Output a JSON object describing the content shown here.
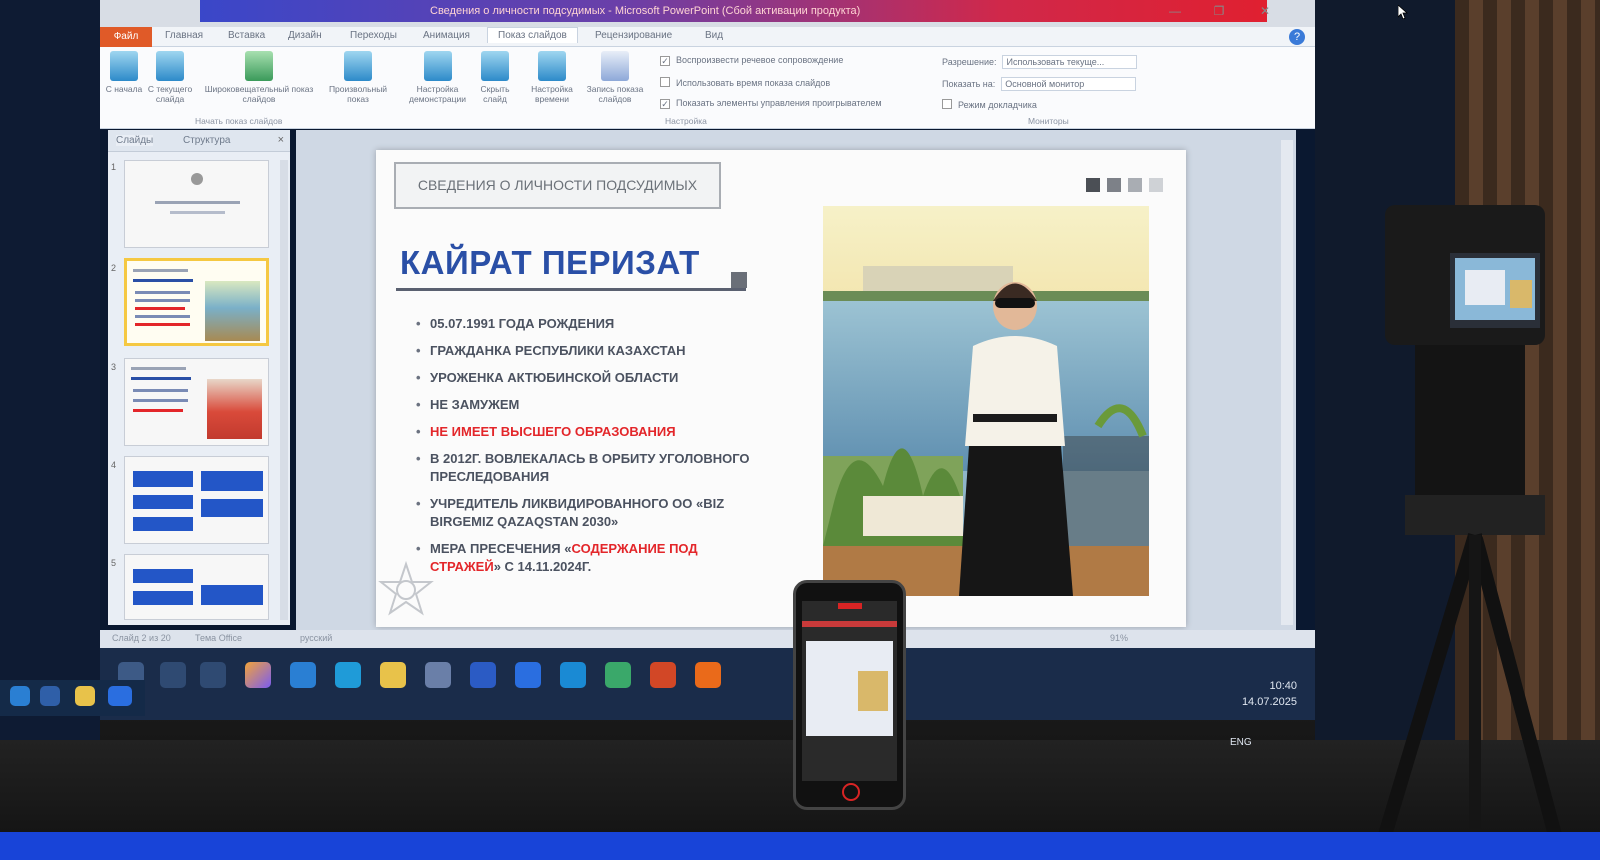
{
  "window": {
    "title": "Сведения о личности подсудимых - Microsoft PowerPoint (Сбой активации продукта)",
    "minimize": "—",
    "maximize": "❐",
    "close": "✕"
  },
  "ribbon": {
    "tabs": [
      "Файл",
      "Главная",
      "Вставка",
      "Дизайн",
      "Переходы",
      "Анимация",
      "Показ слайдов",
      "Рецензирование",
      "Вид"
    ],
    "active_tab": "Показ слайдов",
    "buttons": [
      {
        "label": "С начала",
        "icon": "slideshow-start-icon"
      },
      {
        "label": "С текущего слайда",
        "icon": "slideshow-current-icon"
      },
      {
        "label": "Широковещательный показ слайдов",
        "icon": "broadcast-icon"
      },
      {
        "label": "Произвольный показ",
        "icon": "custom-show-icon"
      },
      {
        "label": "Настройка демонстрации",
        "icon": "setup-show-icon"
      },
      {
        "label": "Скрыть слайд",
        "icon": "hide-slide-icon"
      },
      {
        "label": "Настройка времени",
        "icon": "rehearse-timings-icon"
      },
      {
        "label": "Запись показа слайдов",
        "icon": "record-show-icon"
      }
    ],
    "groups": [
      "Начать показ слайдов",
      "Настройка",
      "Мониторы"
    ],
    "checkboxes": [
      {
        "label": "Воспроизвести речевое сопровождение",
        "checked": true
      },
      {
        "label": "Использовать время показа слайдов",
        "checked": false
      },
      {
        "label": "Показать элементы управления проигрывателем",
        "checked": true
      }
    ],
    "monitors": {
      "resolution_label": "Разрешение:",
      "resolution_value": "Использовать текуще...",
      "show_on_label": "Показать на:",
      "show_on_value": "Основной монитор",
      "presenter_label": "Режим докладчика"
    }
  },
  "panel": {
    "tabs": [
      "Слайды",
      "Структура"
    ],
    "close": "×",
    "slides": [
      "1",
      "2",
      "3",
      "4",
      "5"
    ],
    "selected_slide": 2
  },
  "slide": {
    "header": "СВЕДЕНИЯ О ЛИЧНОСТИ ПОДСУДИМЫХ",
    "name": "КАЙРАТ ПЕРИЗАТ",
    "bullets": [
      "05.07.1991 ГОДА РОЖДЕНИЯ",
      "ГРАЖДАНКА РЕСПУБЛИКИ КАЗАХСТАН",
      "УРОЖЕНКА АКТЮБИНСКОЙ ОБЛАСТИ",
      "НЕ ЗАМУЖЕМ",
      "НЕ ИМЕЕТ ВЫСШЕГО ОБРАЗОВАНИЯ",
      "В 2012Г. ВОВЛЕКАЛАСЬ В ОРБИТУ УГОЛОВНОГО ПРЕСЛЕДОВАНИЯ",
      "УЧРЕДИТЕЛЬ ЛИКВИДИРОВАННОГО ОО «BIZ BIRGEMIZ QAZAQSTAN 2030»"
    ],
    "last_bullet_prefix": "МЕРА ПРЕСЕЧЕНИЯ «",
    "last_bullet_red": "СОДЕРЖАНИЕ ПОД СТРАЖЕЙ",
    "last_bullet_suffix": "» С 14.11.2024Г.",
    "square_colors": [
      "#4b4f55",
      "#7d8188",
      "#a9adb3",
      "#cfd2d6"
    ]
  },
  "status": {
    "slide_info": "Слайд 2 из 20",
    "theme": "Тема Office",
    "language": "русский",
    "zoom": "91%"
  },
  "taskbar": {
    "icons": [
      "windows-start-icon",
      "search-icon",
      "task-view-icon",
      "copilot-icon",
      "edge-icon",
      "edge-icon",
      "file-explorer-icon",
      "store-icon",
      "word-icon",
      "zoom-icon",
      "skype-icon",
      "app-icon",
      "powerpoint-icon",
      "firefox-icon"
    ],
    "time": "10:40",
    "date": "14.07.2025",
    "language": "ENG"
  },
  "colors": {
    "accent_blue": "#2a4fa6",
    "alert_red": "#e3262a",
    "file_tab": "#e05a28"
  }
}
